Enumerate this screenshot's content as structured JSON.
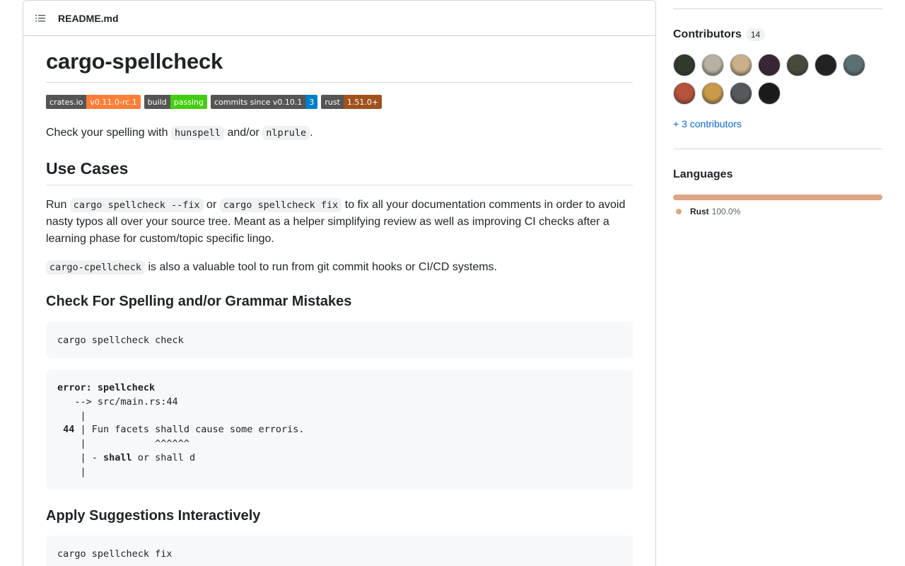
{
  "readme": {
    "filename": "README.md",
    "title": "cargo-spellcheck",
    "badges": [
      {
        "label": "crates.io",
        "value": "v0.11.0-rc.1",
        "color": "#fe7d37"
      },
      {
        "label": "build",
        "value": "passing",
        "color": "#44cc11"
      },
      {
        "label": "commits since v0.10.1",
        "value": "3",
        "color": "#007ec6"
      },
      {
        "label": "rust",
        "value": "1.51.0+",
        "color": "#a0521d"
      }
    ],
    "intro": {
      "before": "Check your spelling with ",
      "code1": "hunspell",
      "middle": " and/or ",
      "code2": "nlprule",
      "after": "."
    },
    "use_cases": {
      "heading": "Use Cases",
      "p1": {
        "t1": "Run ",
        "c1": "cargo spellcheck --fix",
        "t2": " or ",
        "c2": "cargo spellcheck fix",
        "t3": " to fix all your documentation comments in order to avoid nasty typos all over your source tree. Meant as a helper simplifying review as well as improving CI checks after a learning phase for custom/topic specific lingo."
      },
      "p2": {
        "c1": "cargo-cpellcheck",
        "t1": " is also a valuable tool to run from git commit hooks or CI/CD systems."
      }
    },
    "check_section": {
      "heading": "Check For Spelling and/or Grammar Mistakes",
      "command": "cargo spellcheck check",
      "output": {
        "error_label": "error: spellcheck",
        "location": "   --> src/main.rs:44",
        "pipe1": "    |",
        "line_no": " 44",
        "line_text": " | Fun facets shalld cause some erroris.",
        "carets": "    |            ^^^^^^",
        "suggest_prefix": "    | - ",
        "suggest_word": "shall",
        "suggest_rest": " or shall d",
        "pipe2": "    |"
      }
    },
    "apply_section": {
      "heading": "Apply Suggestions Interactively",
      "command": "cargo spellcheck fix"
    }
  },
  "sidebar": {
    "contributors": {
      "title": "Contributors",
      "count": "14",
      "more_link": "+ 3 contributors",
      "avatars": [
        {
          "name": "contributor-1",
          "color": "#2f3a2a"
        },
        {
          "name": "contributor-2",
          "color": "#b8b0a2"
        },
        {
          "name": "contributor-3",
          "color": "#c9b08a"
        },
        {
          "name": "contributor-4",
          "color": "#3a2533"
        },
        {
          "name": "contributor-5",
          "color": "#4a4a3a"
        },
        {
          "name": "contributor-6",
          "color": "#222222"
        },
        {
          "name": "contributor-7",
          "color": "#5c6f73"
        },
        {
          "name": "contributor-8",
          "color": "#b5543a"
        },
        {
          "name": "contributor-9",
          "color": "#c99a4a"
        },
        {
          "name": "contributor-10",
          "color": "#55585c"
        },
        {
          "name": "contributor-11",
          "color": "#1a1a1a"
        }
      ]
    },
    "languages": {
      "title": "Languages",
      "items": [
        {
          "name": "Rust",
          "percent": "100.0%",
          "color": "#dea584"
        }
      ]
    }
  }
}
